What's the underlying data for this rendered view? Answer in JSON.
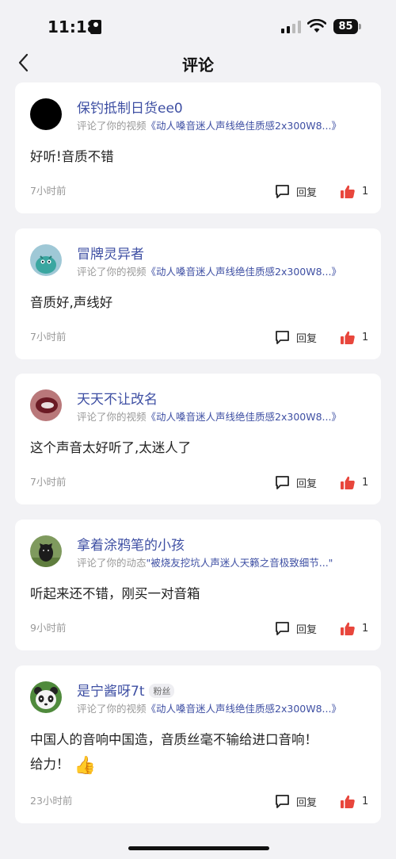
{
  "status_bar": {
    "time": "11:18",
    "battery": "85"
  },
  "nav": {
    "title": "评论"
  },
  "labels": {
    "reply": "回复"
  },
  "comments": [
    {
      "username": "保钓抵制日货ee0",
      "action": "评论了你的视频",
      "target": "《动人嗓音迷人声线绝佳质感2x300W8...》",
      "content": "好听!音质不错",
      "time": "7小时前",
      "likes": "1",
      "avatar_icon": "black-circle-avatar"
    },
    {
      "username": "冒牌灵异者",
      "action": "评论了你的视频",
      "target": "《动人嗓音迷人声线绝佳质感2x300W8...》",
      "content": "音质好,声线好",
      "time": "7小时前",
      "likes": "1",
      "avatar_icon": "teal-creature-avatar"
    },
    {
      "username": "天天不让改名",
      "action": "评论了你的视频",
      "target": "《动人嗓音迷人声线绝佳质感2x300W8...》",
      "content": "这个声音太好听了,太迷人了",
      "time": "7小时前",
      "likes": "1",
      "avatar_icon": "lips-avatar"
    },
    {
      "username": "拿着涂鸦笔的小孩",
      "action": "评论了你的动态",
      "target": "\"被烧友挖坑人声迷人天籁之音极致细节...\"",
      "content": "听起来还不错，刚买一对音箱",
      "time": "9小时前",
      "likes": "1",
      "avatar_icon": "dog-avatar"
    },
    {
      "username": "是宁酱呀7t",
      "badge": "粉丝",
      "action": "评论了你的视频",
      "target": "《动人嗓音迷人声线绝佳质感2x300W8...》",
      "content": "中国人的音响中国造，音质丝毫不输给进口音响！",
      "content_line2": "给力！",
      "time": "23小时前",
      "likes": "1",
      "avatar_icon": "panda-avatar"
    }
  ]
}
